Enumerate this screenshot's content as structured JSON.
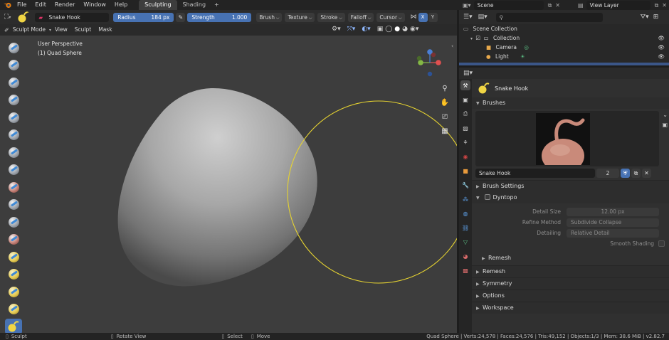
{
  "menu": {
    "items": [
      "File",
      "Edit",
      "Render",
      "Window",
      "Help"
    ],
    "tabs": [
      "Sculpting",
      "Shading"
    ],
    "add_tab": "+",
    "scene": "Scene",
    "view_layer": "View Layer"
  },
  "tool_header": {
    "brush_name": "Snake Hook",
    "radius_label": "Radius",
    "radius_value": "184 px",
    "strength_label": "Strength",
    "strength_value": "1.000",
    "dropdowns": [
      "Brush",
      "Texture",
      "Stroke",
      "Falloff",
      "Cursor"
    ]
  },
  "view_header": {
    "mode": "Sculpt Mode",
    "menus": [
      "View",
      "Sculpt",
      "Mask"
    ]
  },
  "viewport": {
    "perspective": "User Perspective",
    "object": "(1) Quad Sphere",
    "gizmo_axes": [
      "X",
      "Y",
      "Z"
    ],
    "accent_brush_circle": "#e6d331"
  },
  "outliner": {
    "search_placeholder": "",
    "scene_collection": "Scene Collection",
    "collection": "Collection",
    "items": [
      "Camera",
      "Light"
    ]
  },
  "properties": {
    "brush_name": "Snake Hook",
    "brushes_panel": "Brushes",
    "brush_field": "Snake Hook",
    "brush_users": "2",
    "brush_settings_panel": "Brush Settings",
    "dyntopo_panel": "Dyntopo",
    "detail_size_label": "Detail Size",
    "detail_size_value": "12.00 px",
    "refine_method_label": "Refine Method",
    "refine_method_value": "Subdivide Collapse",
    "detailing_label": "Detailing",
    "detailing_value": "Relative Detail",
    "smooth_shading_label": "Smooth Shading",
    "remesh_sub": "Remesh",
    "panels": [
      "Remesh",
      "Symmetry",
      "Options",
      "Workspace"
    ]
  },
  "statusbar": {
    "left": "Sculpt",
    "rotate": "Rotate View",
    "select": "Select",
    "move": "Move",
    "stats": "Quad Sphere | Verts:24,578 | Faces:24,576 | Tris:49,152 | Objects:1/3 | Mem: 38.6 MiB | v2.82.7"
  },
  "colors": {
    "accent": "#4772b3",
    "selection": "#3b5688"
  }
}
